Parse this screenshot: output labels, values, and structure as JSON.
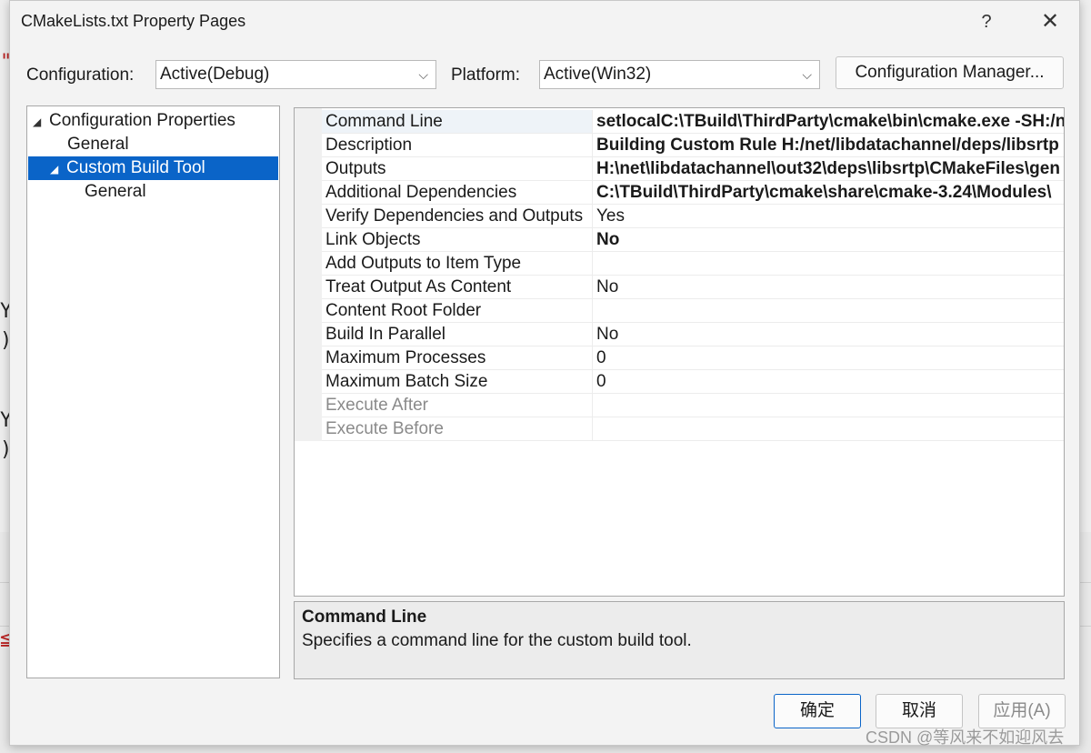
{
  "background": {
    "frags": [
      "\"",
      "Y",
      ")",
      "Y",
      ")",
      "≦"
    ]
  },
  "dialog": {
    "title": "CMakeLists.txt Property Pages",
    "help_glyph": "?",
    "close_glyph": "✕"
  },
  "config": {
    "configuration_label": "Configuration:",
    "configuration_value": "Active(Debug)",
    "platform_label": "Platform:",
    "platform_value": "Active(Win32)",
    "manager_button": "Configuration Manager..."
  },
  "tree": {
    "items": [
      {
        "label": "Configuration Properties",
        "expanded": true,
        "selected": false
      },
      {
        "label": "General",
        "selected": false
      },
      {
        "label": "Custom Build Tool",
        "expanded": true,
        "selected": true
      },
      {
        "label": "General",
        "selected": false
      }
    ]
  },
  "grid": {
    "rows": [
      {
        "name": "Command Line",
        "value": "setlocalC:\\TBuild\\ThirdParty\\cmake\\bin\\cmake.exe -SH:/n",
        "bold": true,
        "disabled": false
      },
      {
        "name": "Description",
        "value": "Building Custom Rule H:/net/libdatachannel/deps/libsrtp",
        "bold": true,
        "disabled": false
      },
      {
        "name": "Outputs",
        "value": "H:\\net\\libdatachannel\\out32\\deps\\libsrtp\\CMakeFiles\\gen",
        "bold": true,
        "disabled": false
      },
      {
        "name": "Additional Dependencies",
        "value": "C:\\TBuild\\ThirdParty\\cmake\\share\\cmake-3.24\\Modules\\",
        "bold": true,
        "disabled": false
      },
      {
        "name": "Verify Dependencies and Outputs",
        "value": "Yes",
        "bold": false,
        "disabled": false
      },
      {
        "name": "Link Objects",
        "value": "No",
        "bold": true,
        "disabled": false
      },
      {
        "name": "Add Outputs to Item Type",
        "value": "",
        "bold": false,
        "disabled": false
      },
      {
        "name": "Treat Output As Content",
        "value": "No",
        "bold": false,
        "disabled": false
      },
      {
        "name": "Content Root Folder",
        "value": "",
        "bold": false,
        "disabled": false
      },
      {
        "name": "Build In Parallel",
        "value": "No",
        "bold": false,
        "disabled": false
      },
      {
        "name": "Maximum Processes",
        "value": "0",
        "bold": false,
        "disabled": false
      },
      {
        "name": "Maximum Batch Size",
        "value": "0",
        "bold": false,
        "disabled": false
      },
      {
        "name": "Execute After",
        "value": "",
        "bold": false,
        "disabled": true
      },
      {
        "name": "Execute Before",
        "value": "",
        "bold": false,
        "disabled": true
      }
    ]
  },
  "description": {
    "title": "Command Line",
    "text": "Specifies a command line for the custom build tool."
  },
  "buttons": {
    "ok": "确定",
    "cancel": "取消",
    "apply": "应用(A)"
  },
  "watermark": "CSDN @等风来不如迎风去",
  "colors": {
    "selection": "#0a64c8",
    "dialog_bg": "#f3f3f3",
    "disabled_text": "#8a8a8a"
  }
}
